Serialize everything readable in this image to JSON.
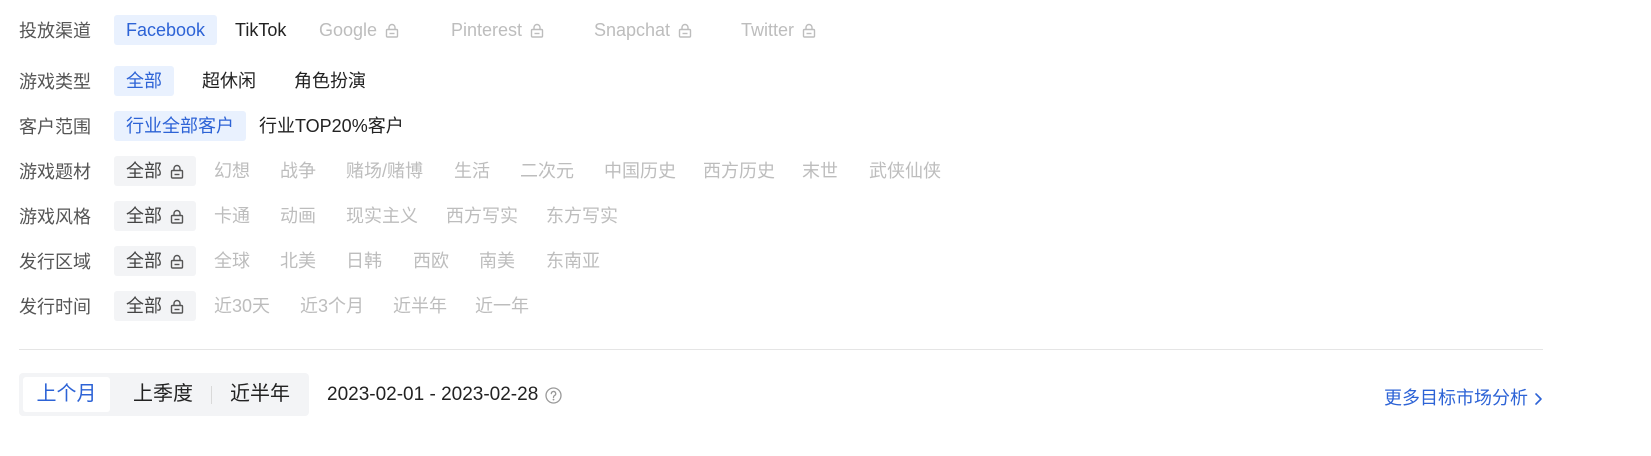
{
  "filters": [
    {
      "label": "投放渠道",
      "options": [
        {
          "label": "Facebook",
          "state": "active"
        },
        {
          "label": "TikTok",
          "state": "normal"
        },
        {
          "label": "Google",
          "state": "disabled",
          "locked": true
        },
        {
          "label": "Pinterest",
          "state": "disabled",
          "locked": true
        },
        {
          "label": "Snapchat",
          "state": "disabled",
          "locked": true
        },
        {
          "label": "Twitter",
          "state": "disabled",
          "locked": true
        }
      ]
    },
    {
      "label": "游戏类型",
      "options": [
        {
          "label": "全部",
          "state": "active"
        },
        {
          "label": "超休闲",
          "state": "normal"
        },
        {
          "label": "角色扮演",
          "state": "normal"
        }
      ]
    },
    {
      "label": "客户范围",
      "options": [
        {
          "label": "行业全部客户",
          "state": "active"
        },
        {
          "label": "行业TOP20%客户",
          "state": "normal"
        }
      ]
    },
    {
      "label": "游戏题材",
      "options": [
        {
          "label": "全部",
          "state": "locked-all",
          "locked": true
        },
        {
          "label": "幻想",
          "state": "disabled"
        },
        {
          "label": "战争",
          "state": "disabled"
        },
        {
          "label": "赌场/赌博",
          "state": "disabled"
        },
        {
          "label": "生活",
          "state": "disabled"
        },
        {
          "label": "二次元",
          "state": "disabled"
        },
        {
          "label": "中国历史",
          "state": "disabled"
        },
        {
          "label": "西方历史",
          "state": "disabled"
        },
        {
          "label": "末世",
          "state": "disabled"
        },
        {
          "label": "武侠仙侠",
          "state": "disabled"
        }
      ]
    },
    {
      "label": "游戏风格",
      "options": [
        {
          "label": "全部",
          "state": "locked-all",
          "locked": true
        },
        {
          "label": "卡通",
          "state": "disabled"
        },
        {
          "label": "动画",
          "state": "disabled"
        },
        {
          "label": "现实主义",
          "state": "disabled"
        },
        {
          "label": "西方写实",
          "state": "disabled"
        },
        {
          "label": "东方写实",
          "state": "disabled"
        }
      ]
    },
    {
      "label": "发行区域",
      "options": [
        {
          "label": "全部",
          "state": "locked-all",
          "locked": true
        },
        {
          "label": "全球",
          "state": "disabled"
        },
        {
          "label": "北美",
          "state": "disabled"
        },
        {
          "label": "日韩",
          "state": "disabled"
        },
        {
          "label": "西欧",
          "state": "disabled"
        },
        {
          "label": "南美",
          "state": "disabled"
        },
        {
          "label": "东南亚",
          "state": "disabled"
        }
      ]
    },
    {
      "label": "发行时间",
      "options": [
        {
          "label": "全部",
          "state": "locked-all",
          "locked": true
        },
        {
          "label": "近30天",
          "state": "disabled"
        },
        {
          "label": "近3个月",
          "state": "disabled"
        },
        {
          "label": "近半年",
          "state": "disabled"
        },
        {
          "label": "近一年",
          "state": "disabled"
        }
      ]
    }
  ],
  "period": {
    "options": [
      {
        "label": "上个月",
        "state": "active"
      },
      {
        "label": "上季度",
        "state": "normal"
      },
      {
        "label": "近半年",
        "state": "normal"
      }
    ]
  },
  "date_range": "2023-02-01 - 2023-02-28",
  "more_link": "更多目标市场分析",
  "colors": {
    "accent": "#2d63d6",
    "active_bg": "#e9f1fe",
    "disabled": "#bdbdbd"
  },
  "icons": {
    "lock": "lock-icon",
    "help": "help-circle-icon",
    "chevron": "chevron-right-icon"
  }
}
